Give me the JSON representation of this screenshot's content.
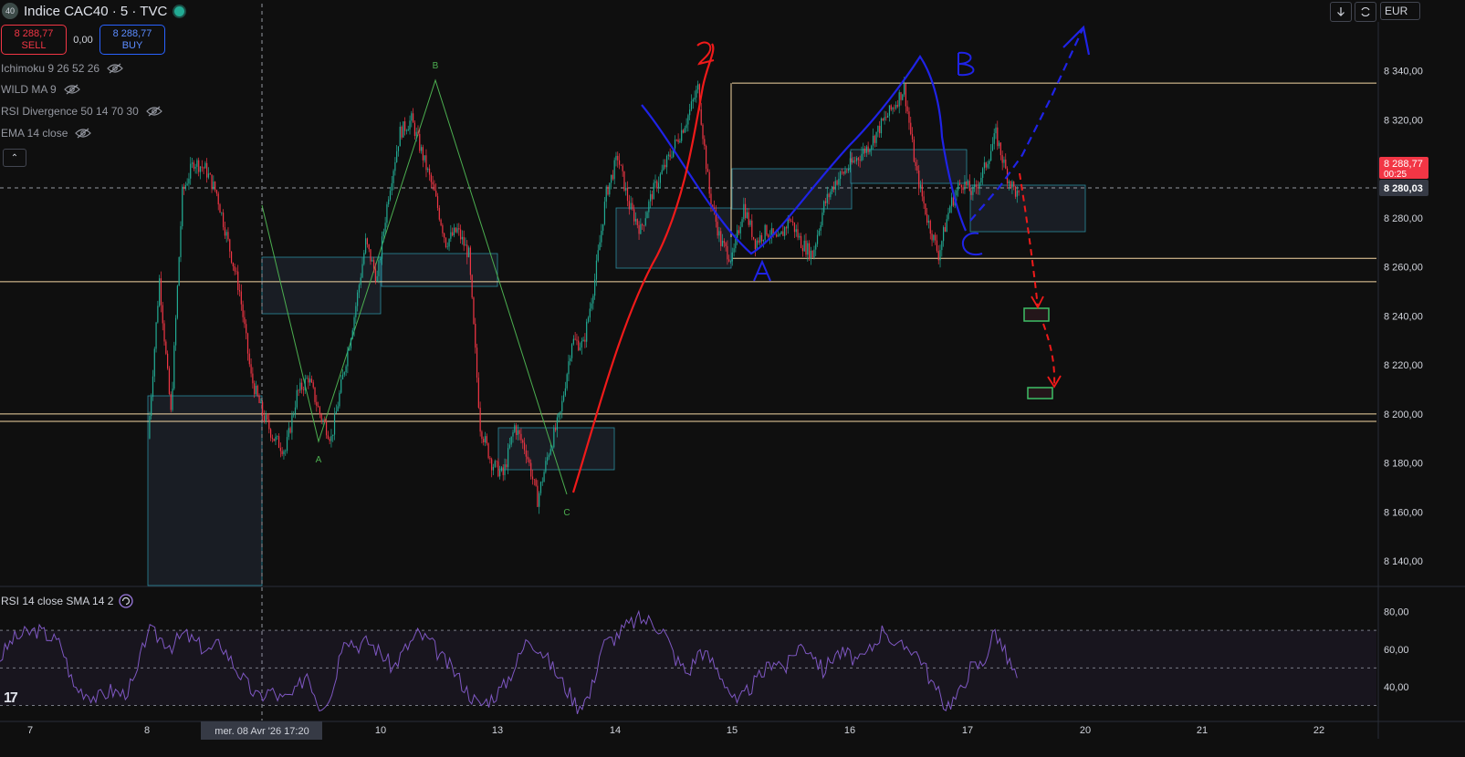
{
  "header": {
    "symbol_badge": "40",
    "title": "Indice CAC40 · 5 · TVC",
    "sell_price": "8 288,77",
    "sell_label": "SELL",
    "spread": "0,00",
    "buy_price": "8 288,77",
    "buy_label": "BUY",
    "currency": "EUR",
    "download_icon": "arrow-down-icon",
    "refresh_icon": "refresh-icon",
    "collapse_glyph": "⌃"
  },
  "indicators": [
    {
      "label": "Ichimoku 9 26 52 26"
    },
    {
      "label": "WILD MA 9"
    },
    {
      "label": "RSI Divergence 50 14 70 30"
    },
    {
      "label": "EMA 14 close"
    }
  ],
  "rsi_legend": "RSI 14 close SMA 14 2",
  "tv_logo": "17",
  "colors": {
    "background": "#0f0f0f",
    "up": "#22ab94",
    "down": "#f23645",
    "rsi": "#7e57c2",
    "drawing_blue": "#1f23e6",
    "drawing_red": "#f01a1a",
    "hline": "#f5d7a3",
    "zone_border": "#2a8c9e"
  },
  "chart_data": {
    "type": "candlestick",
    "price_axis": {
      "ticks": [
        "8 340,00",
        "8 320,00",
        "8 300,00",
        "8 280,00",
        "8 260,00",
        "8 240,00",
        "8 220,00",
        "8 200,00",
        "8 180,00",
        "8 160,00",
        "8 140,00"
      ],
      "values": [
        8340,
        8320,
        8300,
        8280,
        8260,
        8240,
        8220,
        8200,
        8180,
        8160,
        8140
      ],
      "range": [
        8130,
        8360
      ]
    },
    "rsi_axis": {
      "ticks": [
        "80,00",
        "60,00",
        "40,00"
      ],
      "values": [
        80,
        60,
        40
      ],
      "range": [
        22,
        90
      ],
      "band": [
        30,
        70
      ],
      "mid": 50
    },
    "time_axis": {
      "labels": [
        "7",
        "8",
        "10",
        "13",
        "14",
        "15",
        "16",
        "17",
        "20",
        "21",
        "22"
      ],
      "crosshair_label": "mer. 08 Avr '26   17:20"
    },
    "last_price_label": "8 288,77",
    "countdown_label": "00:25",
    "crosshair_price_label": "8 280,03",
    "price_path": [
      [
        0,
        8190
      ],
      [
        1,
        8255
      ],
      [
        2,
        8200
      ],
      [
        3,
        8290
      ],
      [
        4,
        8303
      ],
      [
        5,
        8300
      ],
      [
        6,
        8290
      ],
      [
        7,
        8270
      ],
      [
        8,
        8250
      ],
      [
        9,
        8215
      ],
      [
        10,
        8200
      ],
      [
        11,
        8190
      ],
      [
        12,
        8185
      ],
      [
        13,
        8208
      ],
      [
        14,
        8215
      ],
      [
        15,
        8200
      ],
      [
        16,
        8190
      ],
      [
        17,
        8215
      ],
      [
        18,
        8240
      ],
      [
        19,
        8270
      ],
      [
        20,
        8255
      ],
      [
        21,
        8290
      ],
      [
        22,
        8315
      ],
      [
        23,
        8320
      ],
      [
        24,
        8305
      ],
      [
        25,
        8290
      ],
      [
        26,
        8270
      ],
      [
        27,
        8275
      ],
      [
        28,
        8265
      ],
      [
        29,
        8195
      ],
      [
        30,
        8180
      ],
      [
        31,
        8175
      ],
      [
        32,
        8195
      ],
      [
        33,
        8185
      ],
      [
        34,
        8165
      ],
      [
        35,
        8185
      ],
      [
        36,
        8200
      ],
      [
        37,
        8230
      ],
      [
        38,
        8228
      ],
      [
        39,
        8255
      ],
      [
        40,
        8290
      ],
      [
        41,
        8305
      ],
      [
        42,
        8285
      ],
      [
        43,
        8275
      ],
      [
        44,
        8290
      ],
      [
        45,
        8300
      ],
      [
        46,
        8310
      ],
      [
        47,
        8320
      ],
      [
        48,
        8333
      ],
      [
        49,
        8290
      ],
      [
        50,
        8270
      ],
      [
        51,
        8263
      ],
      [
        52,
        8285
      ],
      [
        53,
        8270
      ],
      [
        54,
        8275
      ],
      [
        55,
        8270
      ],
      [
        56,
        8280
      ],
      [
        57,
        8270
      ],
      [
        58,
        8265
      ],
      [
        59,
        8285
      ],
      [
        60,
        8295
      ],
      [
        61,
        8300
      ],
      [
        62,
        8305
      ],
      [
        63,
        8310
      ],
      [
        64,
        8318
      ],
      [
        65,
        8325
      ],
      [
        66,
        8333
      ],
      [
        67,
        8300
      ],
      [
        68,
        8280
      ],
      [
        69,
        8265
      ],
      [
        70,
        8285
      ],
      [
        71,
        8295
      ],
      [
        72,
        8290
      ],
      [
        73,
        8300
      ],
      [
        74,
        8314
      ],
      [
        75,
        8297
      ],
      [
        76,
        8288
      ]
    ],
    "rsi_path": [
      [
        0,
        55
      ],
      [
        1,
        65
      ],
      [
        2,
        68
      ],
      [
        3,
        70
      ],
      [
        4,
        67
      ],
      [
        5,
        62
      ],
      [
        6,
        40
      ],
      [
        7,
        37
      ],
      [
        8,
        34
      ],
      [
        9,
        38
      ],
      [
        10,
        36
      ],
      [
        11,
        43
      ],
      [
        12,
        70
      ],
      [
        13,
        66
      ],
      [
        14,
        62
      ],
      [
        15,
        68
      ],
      [
        16,
        63
      ],
      [
        17,
        59
      ],
      [
        18,
        63
      ],
      [
        19,
        52
      ],
      [
        20,
        42
      ],
      [
        21,
        34
      ],
      [
        22,
        38
      ],
      [
        23,
        33
      ],
      [
        24,
        36
      ],
      [
        25,
        48
      ],
      [
        26,
        30
      ],
      [
        27,
        36
      ],
      [
        28,
        68
      ],
      [
        29,
        62
      ],
      [
        30,
        64
      ],
      [
        31,
        58
      ],
      [
        32,
        50
      ],
      [
        33,
        60
      ],
      [
        34,
        68
      ],
      [
        35,
        64
      ],
      [
        36,
        55
      ],
      [
        37,
        48
      ],
      [
        38,
        38
      ],
      [
        39,
        30
      ],
      [
        40,
        34
      ],
      [
        41,
        40
      ],
      [
        42,
        52
      ],
      [
        43,
        66
      ],
      [
        44,
        60
      ],
      [
        45,
        50
      ],
      [
        46,
        40
      ],
      [
        47,
        30
      ],
      [
        48,
        35
      ],
      [
        49,
        62
      ],
      [
        50,
        66
      ],
      [
        51,
        72
      ],
      [
        52,
        76
      ],
      [
        53,
        75
      ],
      [
        54,
        70
      ],
      [
        55,
        55
      ],
      [
        56,
        47
      ],
      [
        57,
        60
      ],
      [
        58,
        53
      ],
      [
        59,
        43
      ],
      [
        60,
        30
      ],
      [
        61,
        39
      ],
      [
        62,
        46
      ],
      [
        63,
        55
      ],
      [
        64,
        50
      ],
      [
        65,
        62
      ],
      [
        66,
        60
      ],
      [
        67,
        48
      ],
      [
        68,
        58
      ],
      [
        69,
        57
      ],
      [
        70,
        53
      ],
      [
        71,
        61
      ],
      [
        72,
        72
      ],
      [
        73,
        60
      ],
      [
        74,
        62
      ],
      [
        75,
        55
      ],
      [
        76,
        40
      ],
      [
        77,
        30
      ],
      [
        78,
        35
      ],
      [
        79,
        50
      ],
      [
        80,
        52
      ],
      [
        81,
        70
      ],
      [
        82,
        55
      ],
      [
        83,
        42
      ]
    ],
    "horizontal_levels": [
      8335,
      8263.5,
      8254,
      8200,
      8197
    ],
    "zigzag_labels": [
      "A",
      "B",
      "C"
    ],
    "hand_labels": {
      "blue": [
        "A",
        "B",
        "C"
      ],
      "red": "2"
    }
  }
}
